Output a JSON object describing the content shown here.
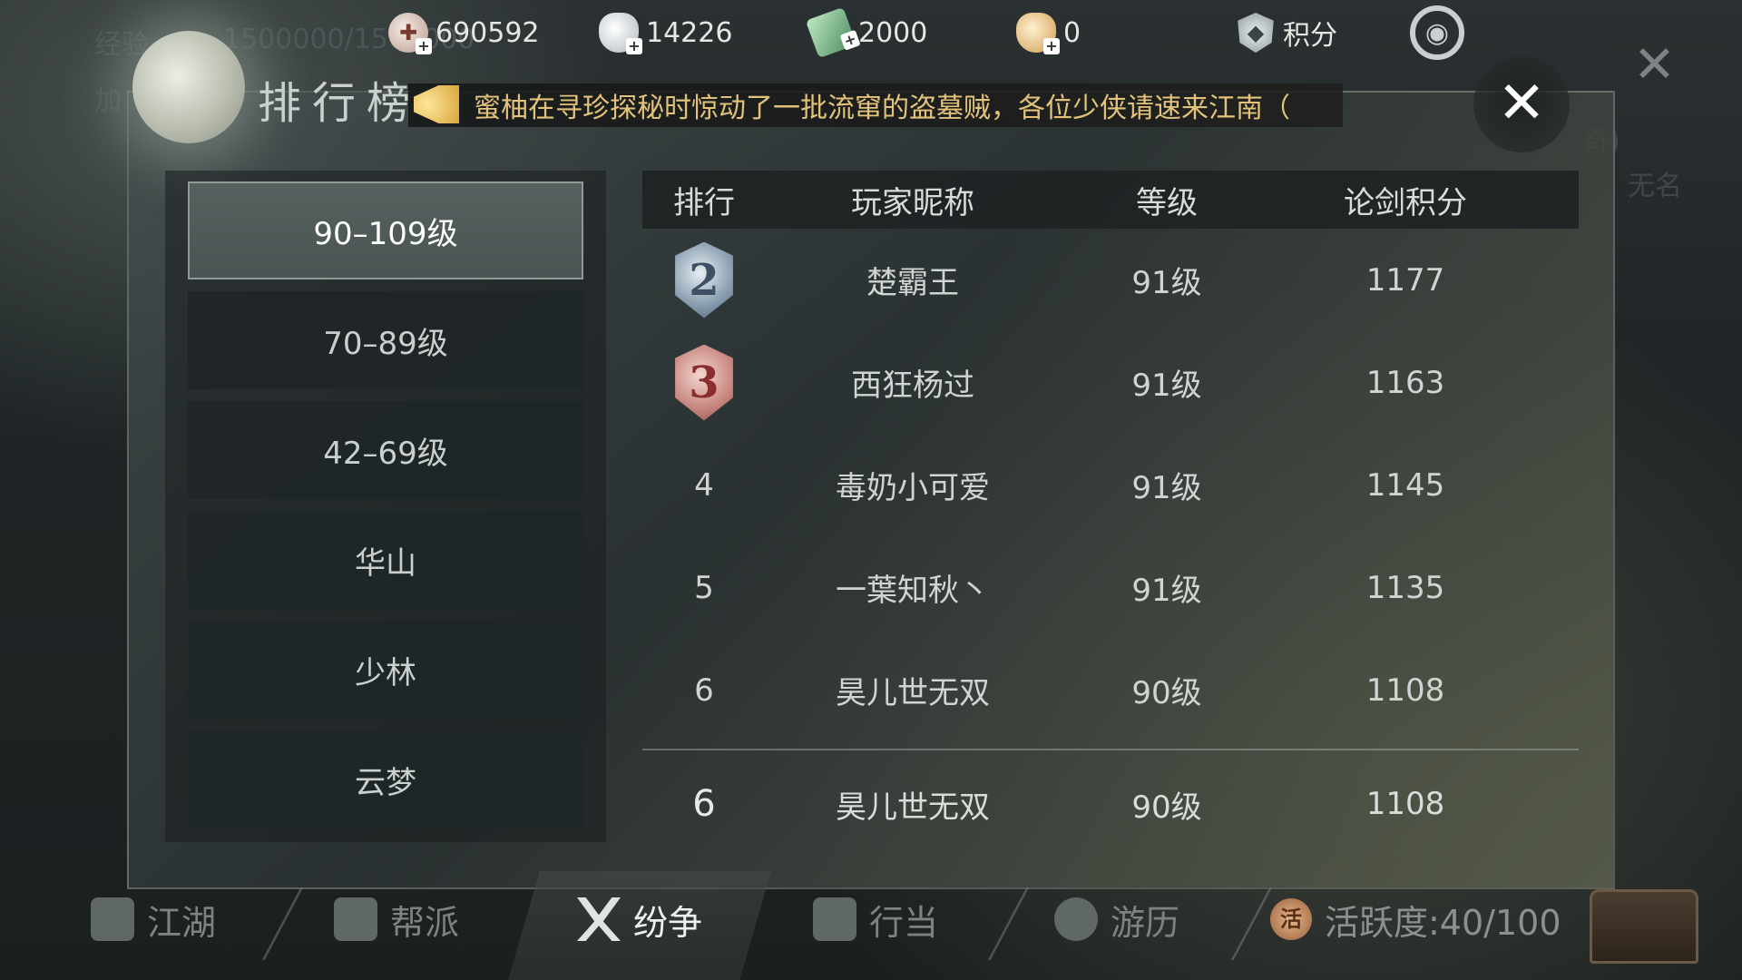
{
  "background": {
    "exp_label": "经验",
    "exp_value": "1500000/1500000",
    "add_label": "加",
    "right_text_1": "奇)",
    "right_text_2": "无名"
  },
  "topbar": {
    "currencies": [
      {
        "icon": "coin-icon",
        "value": "690592"
      },
      {
        "icon": "silver-ingot-icon",
        "value": "14226"
      },
      {
        "icon": "jade-icon",
        "value": "2000"
      },
      {
        "icon": "gold-ingot-icon",
        "value": "0"
      }
    ],
    "points_label": "积分"
  },
  "panel": {
    "title": "排行榜",
    "announcement": "蜜柚在寻珍探秘时惊动了一批流窜的盗墓贼，各位少侠请速来江南（",
    "close_symbol": "✕"
  },
  "tabs": [
    {
      "label": "90–109级",
      "active": true
    },
    {
      "label": "70–89级",
      "active": false
    },
    {
      "label": "42–69级",
      "active": false
    },
    {
      "label": "华山",
      "active": false
    },
    {
      "label": "少林",
      "active": false
    },
    {
      "label": "云梦",
      "active": false
    }
  ],
  "table": {
    "headers": {
      "rank": "排行",
      "name": "玩家昵称",
      "level": "等级",
      "score": "论剑积分"
    },
    "rows": [
      {
        "rank": "2",
        "badge": "silver",
        "name": "楚霸王",
        "level": "91级",
        "score": "1177"
      },
      {
        "rank": "3",
        "badge": "bronze",
        "name": "西狂杨过",
        "level": "91级",
        "score": "1163"
      },
      {
        "rank": "4",
        "badge": "",
        "name": "毒奶小可爱",
        "level": "91级",
        "score": "1145"
      },
      {
        "rank": "5",
        "badge": "",
        "name": "一葉知秋丶",
        "level": "91级",
        "score": "1135"
      },
      {
        "rank": "6",
        "badge": "",
        "name": "昊儿世无双",
        "level": "90级",
        "score": "1108"
      }
    ],
    "my_row": {
      "rank": "6",
      "name": "昊儿世无双",
      "level": "90级",
      "score": "1108"
    }
  },
  "bottom_nav": {
    "items": [
      {
        "label": "江湖",
        "icon": "map-scroll-icon"
      },
      {
        "label": "帮派",
        "icon": "guild-icon"
      },
      {
        "label": "纷争",
        "icon": "crossed-swords-icon",
        "active": true
      },
      {
        "label": "行当",
        "icon": "profession-icon"
      },
      {
        "label": "游历",
        "icon": "magnifier-icon"
      }
    ],
    "activity_icon_text": "活",
    "activity_label": "活跃度:40/100"
  }
}
